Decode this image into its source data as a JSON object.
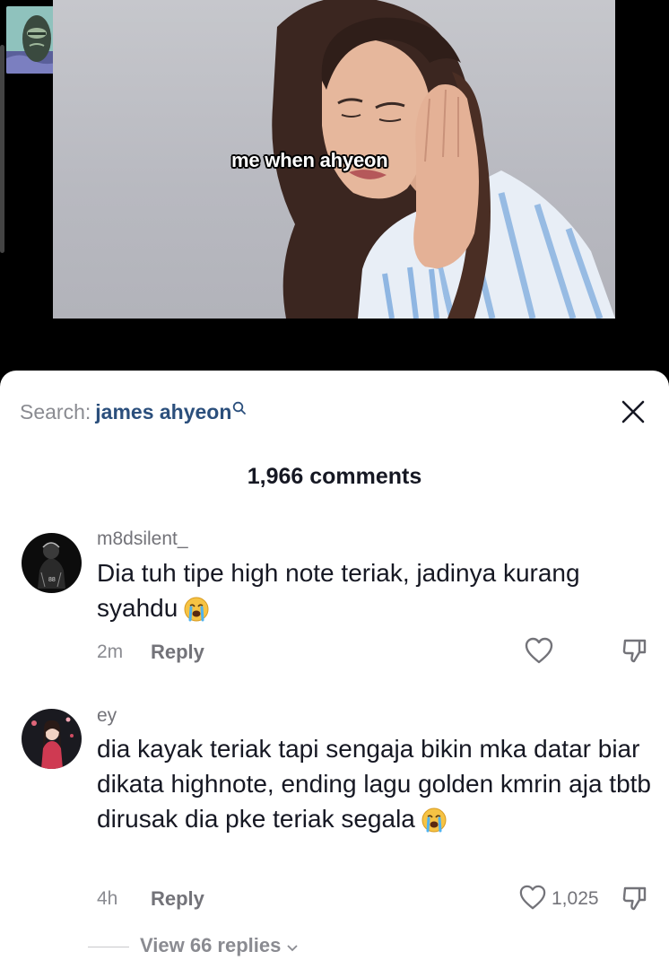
{
  "video": {
    "caption": "me when ahyeon"
  },
  "comments_panel": {
    "search_prefix": "Search:",
    "search_term": "james ahyeon",
    "comments_count": "1,966 comments",
    "comments": [
      {
        "username": "m8dsilent_",
        "text": "Dia tuh tipe high note teriak, jadinya kurang syahdu",
        "emoji": "loudly-crying-face",
        "time": "2m",
        "reply_label": "Reply",
        "likes": ""
      },
      {
        "username": "ey",
        "text": "dia kayak teriak tapi sengaja bikin mka datar biar dikata highnote, ending lagu golden kmrin aja tbtb dirusak dia pke teriak segala",
        "emoji": "loudly-crying-face",
        "time": "4h",
        "reply_label": "Reply",
        "likes": "1,025"
      }
    ],
    "view_replies": "View 66 replies"
  },
  "colors": {
    "search_term": "#2b4f7c",
    "text_primary": "#161823",
    "text_secondary": "#8a8b91"
  }
}
